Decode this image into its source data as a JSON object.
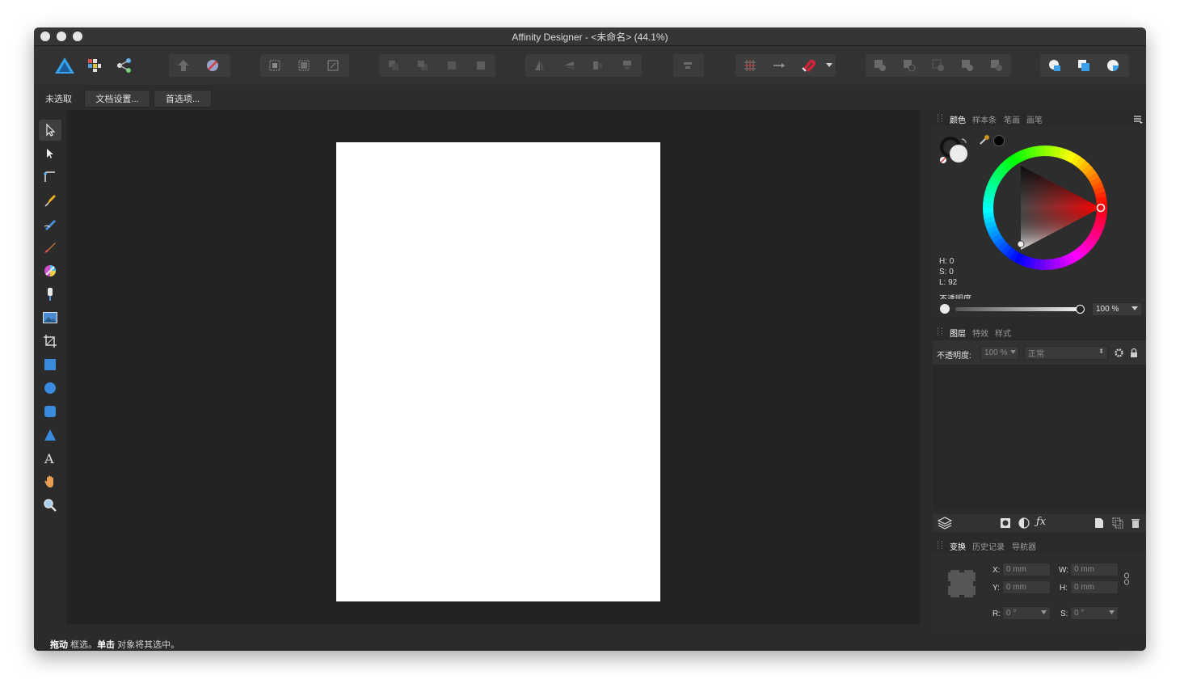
{
  "window": {
    "title": "Affinity Designer - <未命名> (44.1%)"
  },
  "context_bar": {
    "selection_label": "未选取",
    "document_setup_label": "文档设置...",
    "preferences_label": "首选项..."
  },
  "color_panel": {
    "tabs": [
      "颜色",
      "样本条",
      "笔画",
      "画笔"
    ],
    "h_label": "H: 0",
    "s_label": "S: 0",
    "l_label": "L: 92",
    "opacity_label": "不透明度",
    "opacity_value": "100 %"
  },
  "layers_panel": {
    "tabs": [
      "图层",
      "特效",
      "样式"
    ],
    "opacity_label": "不透明度:",
    "opacity_value": "100 %",
    "blend_mode": "正常"
  },
  "transform_panel": {
    "tabs": [
      "变换",
      "历史记录",
      "导航器"
    ],
    "x_label": "X:",
    "x_value": "0 mm",
    "y_label": "Y:",
    "y_value": "0 mm",
    "w_label": "W:",
    "w_value": "0 mm",
    "h_label": "H:",
    "h_value": "0 mm",
    "r_label": "R:",
    "r_value": "0 °",
    "s_label": "S:",
    "s_value": "0 °"
  },
  "status": {
    "drag_bold": "拖动",
    "drag_text": " 框选。",
    "click_bold": "单击",
    "click_text": " 对象将其选中。"
  },
  "colors": {
    "window_bg": "#2b2b2b",
    "canvas_bg": "#232323",
    "artboard": "#ffffff",
    "hue_marker": "#ff2020",
    "snapping_magnet": "#d0243a"
  }
}
